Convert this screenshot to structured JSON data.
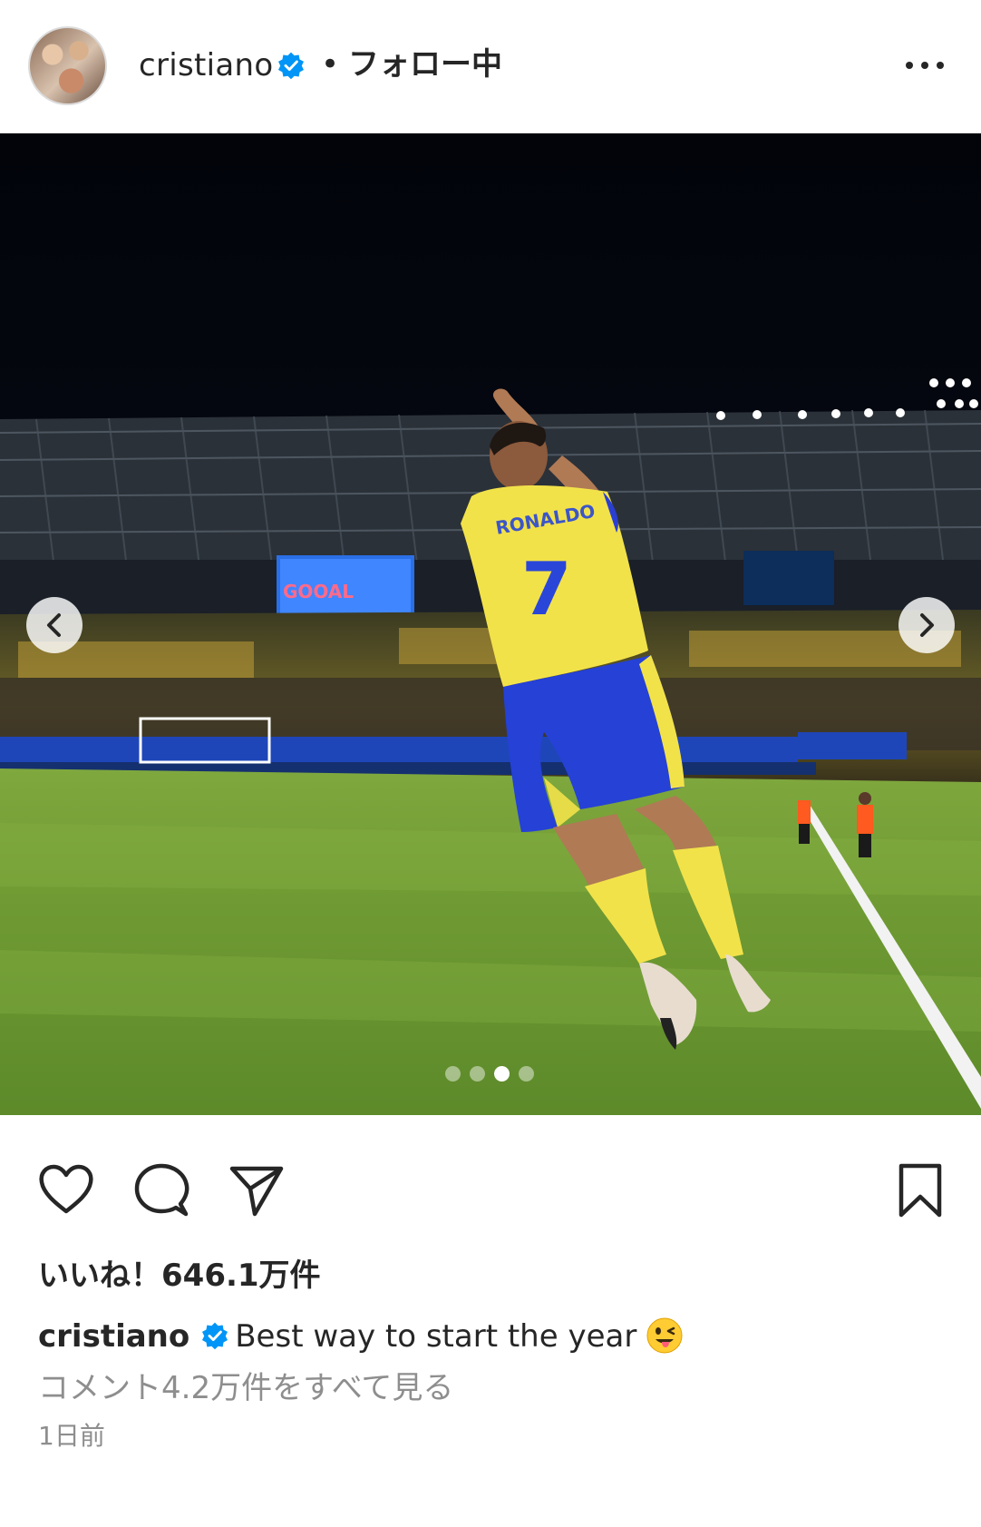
{
  "header": {
    "username": "cristiano",
    "separator": "•",
    "follow_status": "フォロー中",
    "verified": true
  },
  "post": {
    "carousel": {
      "total_slides": 4,
      "active_slide": 3
    },
    "scene_text": {
      "jersey_name": "RONALDO",
      "jersey_number": "7",
      "scoreboard": "GOOAL"
    }
  },
  "actions": {
    "like_icon": "heart-icon",
    "comment_icon": "comment-icon",
    "share_icon": "paper-plane-icon",
    "save_icon": "bookmark-icon"
  },
  "likes_text": "いいね！646.1万件",
  "caption": {
    "username": "cristiano",
    "text": "Best way to start the year"
  },
  "view_comments": "コメント4.2万件をすべて見る",
  "timestamp": "1日前",
  "colors": {
    "verified": "#0095f6",
    "text": "#262626",
    "secondary": "#8e8e8e"
  }
}
